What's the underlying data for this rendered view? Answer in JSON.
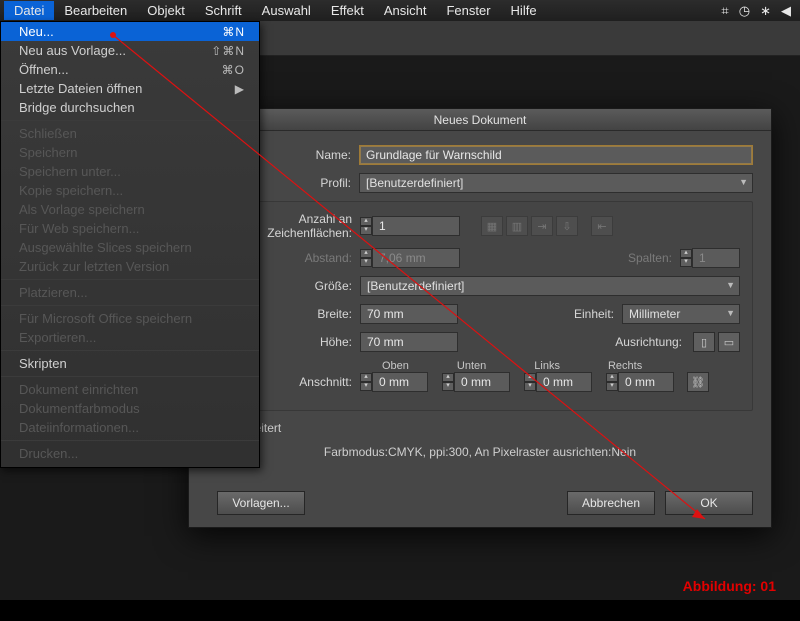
{
  "menubar": {
    "items": [
      "Datei",
      "Bearbeiten",
      "Objekt",
      "Schrift",
      "Auswahl",
      "Effekt",
      "Ansicht",
      "Fenster",
      "Hilfe"
    ]
  },
  "dropdown": {
    "groups": [
      [
        {
          "label": "Neu...",
          "shortcut": "⌘N",
          "hl": true
        },
        {
          "label": "Neu aus Vorlage...",
          "shortcut": "⇧⌘N"
        },
        {
          "label": "Öffnen...",
          "shortcut": "⌘O"
        },
        {
          "label": "Letzte Dateien öffnen",
          "shortcut": "▶"
        },
        {
          "label": "Bridge durchsuchen"
        }
      ],
      [
        {
          "label": "Schließen",
          "dis": true
        },
        {
          "label": "Speichern",
          "dis": true
        },
        {
          "label": "Speichern unter...",
          "dis": true
        },
        {
          "label": "Kopie speichern...",
          "dis": true
        },
        {
          "label": "Als Vorlage speichern",
          "dis": true
        },
        {
          "label": "Für Web speichern...",
          "dis": true
        },
        {
          "label": "Ausgewählte Slices speichern",
          "dis": true
        },
        {
          "label": "Zurück zur letzten Version",
          "dis": true
        }
      ],
      [
        {
          "label": "Platzieren...",
          "dis": true
        }
      ],
      [
        {
          "label": "Für Microsoft Office speichern",
          "dis": true
        },
        {
          "label": "Exportieren...",
          "dis": true
        }
      ],
      [
        {
          "label": "Skripten"
        }
      ],
      [
        {
          "label": "Dokument einrichten",
          "dis": true
        },
        {
          "label": "Dokumentfarbmodus",
          "dis": true
        },
        {
          "label": "Dateiinformationen...",
          "dis": true
        }
      ],
      [
        {
          "label": "Drucken...",
          "dis": true
        }
      ]
    ]
  },
  "dialog": {
    "title": "Neues Dokument",
    "labels": {
      "name": "Name:",
      "profile": "Profil:",
      "artboards": "Anzahl an Zeichenflächen:",
      "spacing": "Abstand:",
      "columns": "Spalten:",
      "size": "Größe:",
      "width": "Breite:",
      "height": "Höhe:",
      "unit": "Einheit:",
      "orient": "Ausrichtung:",
      "bleed": "Anschnitt:",
      "top": "Oben",
      "bottom": "Unten",
      "left": "Links",
      "right": "Rechts",
      "advanced": "Erweitert"
    },
    "values": {
      "name": "Grundlage für Warnschild",
      "profile": "[Benutzerdefiniert]",
      "artboards": "1",
      "spacing": "7,06 mm",
      "columns": "1",
      "size": "[Benutzerdefiniert]",
      "width": "70 mm",
      "height": "70 mm",
      "unit": "Millimeter",
      "bleed": {
        "top": "0 mm",
        "bottom": "0 mm",
        "left": "0 mm",
        "right": "0 mm"
      }
    },
    "summary": "Farbmodus:CMYK, ppi:300, An Pixelraster ausrichten:Nein",
    "buttons": {
      "templates": "Vorlagen...",
      "cancel": "Abbrechen",
      "ok": "OK"
    }
  },
  "caption": "Abbildung: 01"
}
